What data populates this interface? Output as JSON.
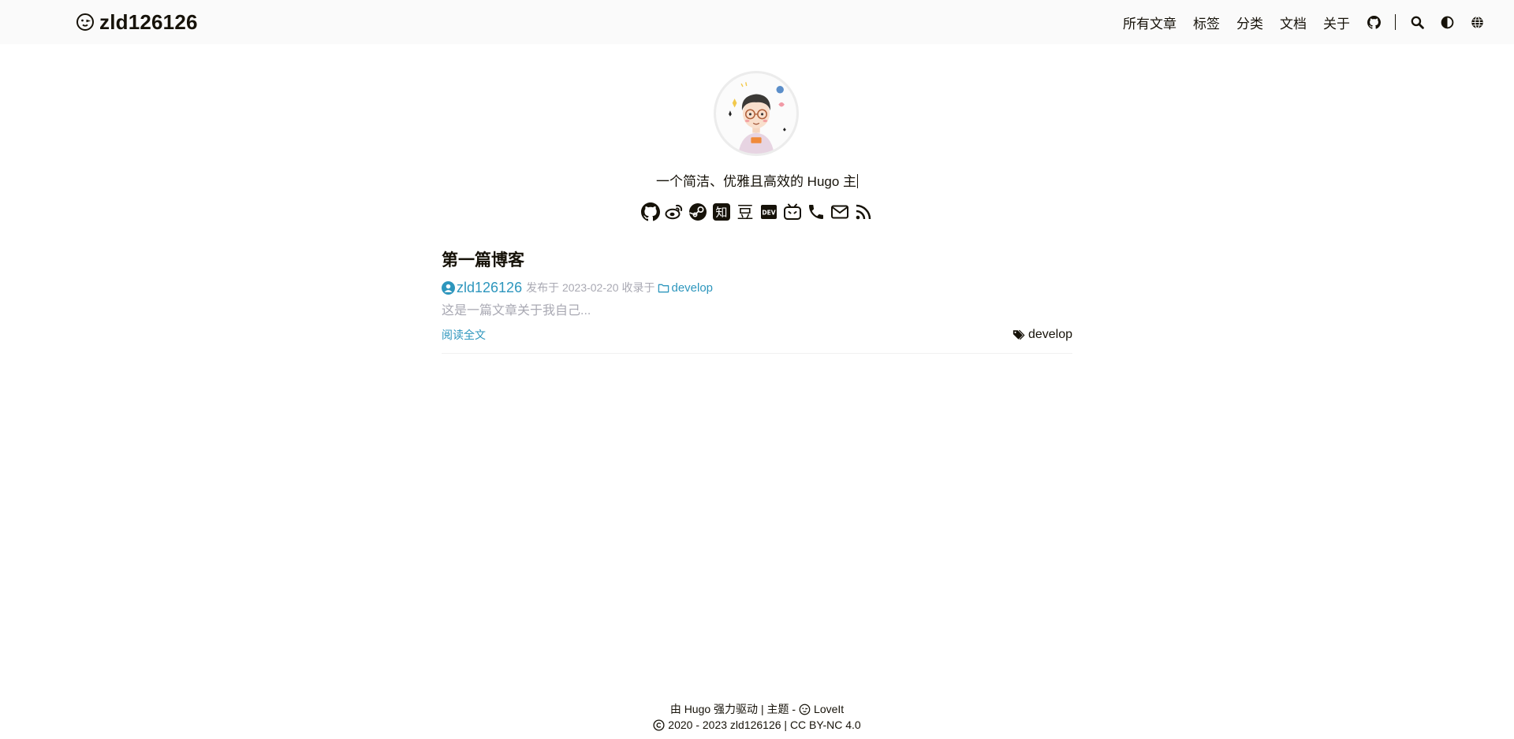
{
  "header": {
    "site_title": "zld126126",
    "nav": {
      "posts": "所有文章",
      "tags": "标签",
      "categories": "分类",
      "docs": "文档",
      "about": "关于"
    },
    "icons": [
      "github-icon",
      "search-icon",
      "theme-toggle-icon",
      "language-globe-icon"
    ]
  },
  "profile": {
    "subtitle": "一个简洁、优雅且高效的 Hugo 主",
    "social_icons": [
      "github-icon",
      "weibo-icon",
      "steam-icon",
      "zhihu-icon",
      "douban-icon",
      "dev-icon",
      "bilibili-icon",
      "phone-icon",
      "email-icon",
      "rss-icon"
    ],
    "zhihu_glyph": "知",
    "douban_glyph": "豆",
    "dev_glyph": "DEV"
  },
  "post": {
    "title": "第一篇博客",
    "author": "zld126126",
    "published_prefix": "发布于 2023-02-20 收录于",
    "category": "develop",
    "summary": "这是一篇文章关于我自己...",
    "read_more": "阅读全文",
    "tag": "develop"
  },
  "footer": {
    "powered_by": "由 Hugo 强力驱动 | 主题 -",
    "theme_name": "LoveIt",
    "copyright": "2020 - 2023 zld126126 | CC BY-NC 4.0"
  },
  "colors": {
    "link": "#2d96bd",
    "muted": "#a9a9b3",
    "text": "#161209",
    "header_bg": "#fafafa"
  }
}
